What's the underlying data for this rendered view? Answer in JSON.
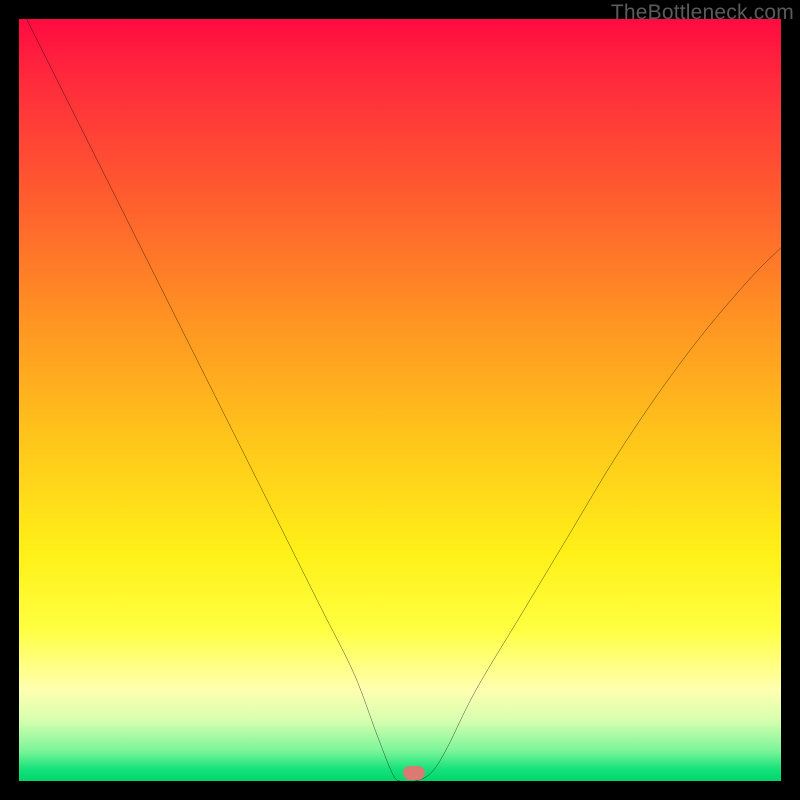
{
  "watermark": {
    "text": "TheBottleneck.com"
  },
  "colors": {
    "frame": "#000000",
    "curve": "#000000",
    "marker": "#d97b70",
    "gradient_top": "#ff0b40",
    "gradient_bottom": "#00d66c"
  },
  "marker": {
    "x_pct": 51.8,
    "y_pct": 99.0
  },
  "chart_data": {
    "type": "line",
    "title": "",
    "xlabel": "",
    "ylabel": "",
    "xlim": [
      0,
      100
    ],
    "ylim": [
      0,
      100
    ],
    "grid": false,
    "legend": false,
    "notes": "V-shaped bottleneck curve; y is mismatch percentage (0 = balanced, at green bottom). Background gradient encodes severity (red=high, green=low). Axes have no tick labels.",
    "series": [
      {
        "name": "bottleneck-curve",
        "x": [
          0,
          4,
          8,
          12,
          16,
          20,
          24,
          28,
          32,
          36,
          40,
          44,
          47,
          49,
          50,
          52,
          54,
          56,
          60,
          66,
          72,
          78,
          84,
          90,
          96,
          100
        ],
        "y": [
          102,
          94,
          86,
          78,
          70,
          62,
          54,
          46,
          38,
          30,
          22,
          14,
          6,
          1,
          0,
          0,
          1,
          4,
          12,
          22,
          32,
          42,
          51,
          59,
          66,
          70
        ]
      }
    ],
    "optimum": {
      "x": 51.8,
      "y": 0
    }
  }
}
